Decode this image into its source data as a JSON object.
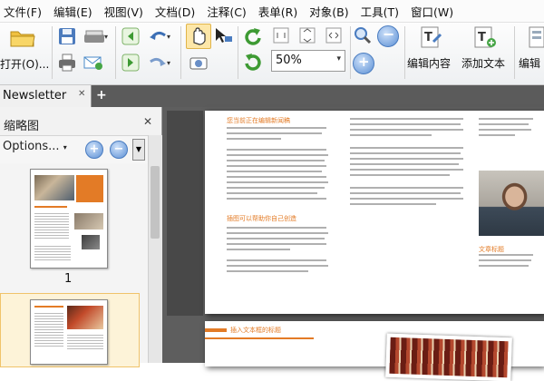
{
  "menu": [
    "文件(F)",
    "编辑(E)",
    "视图(V)",
    "文档(D)",
    "注释(C)",
    "表单(R)",
    "对象(B)",
    "工具(T)",
    "窗口(W)"
  ],
  "toolbar": {
    "open_label": "打开(O)...",
    "zoom_value": "50%",
    "edit_content_label": "编辑内容",
    "add_text_label": "添加文本",
    "edit_label_partial": "编辑"
  },
  "tabs": [
    {
      "label": "Newsletter",
      "close": "✕"
    }
  ],
  "add_tab": "+",
  "panel": {
    "title": "缩略图",
    "close": "✕",
    "options_label": "Options...",
    "page_numbers": [
      "1"
    ]
  },
  "colors": {
    "accent": "#e37b26",
    "canvas": "#5e5e5e",
    "tab_bar": "#5b5b5b"
  },
  "document": {
    "heading1": "您当前正在编辑新闻稿",
    "heading2": "插图可以帮助你自己创造",
    "right_heading": "文章标题",
    "bottom_heading": "插入文本框的标题"
  }
}
